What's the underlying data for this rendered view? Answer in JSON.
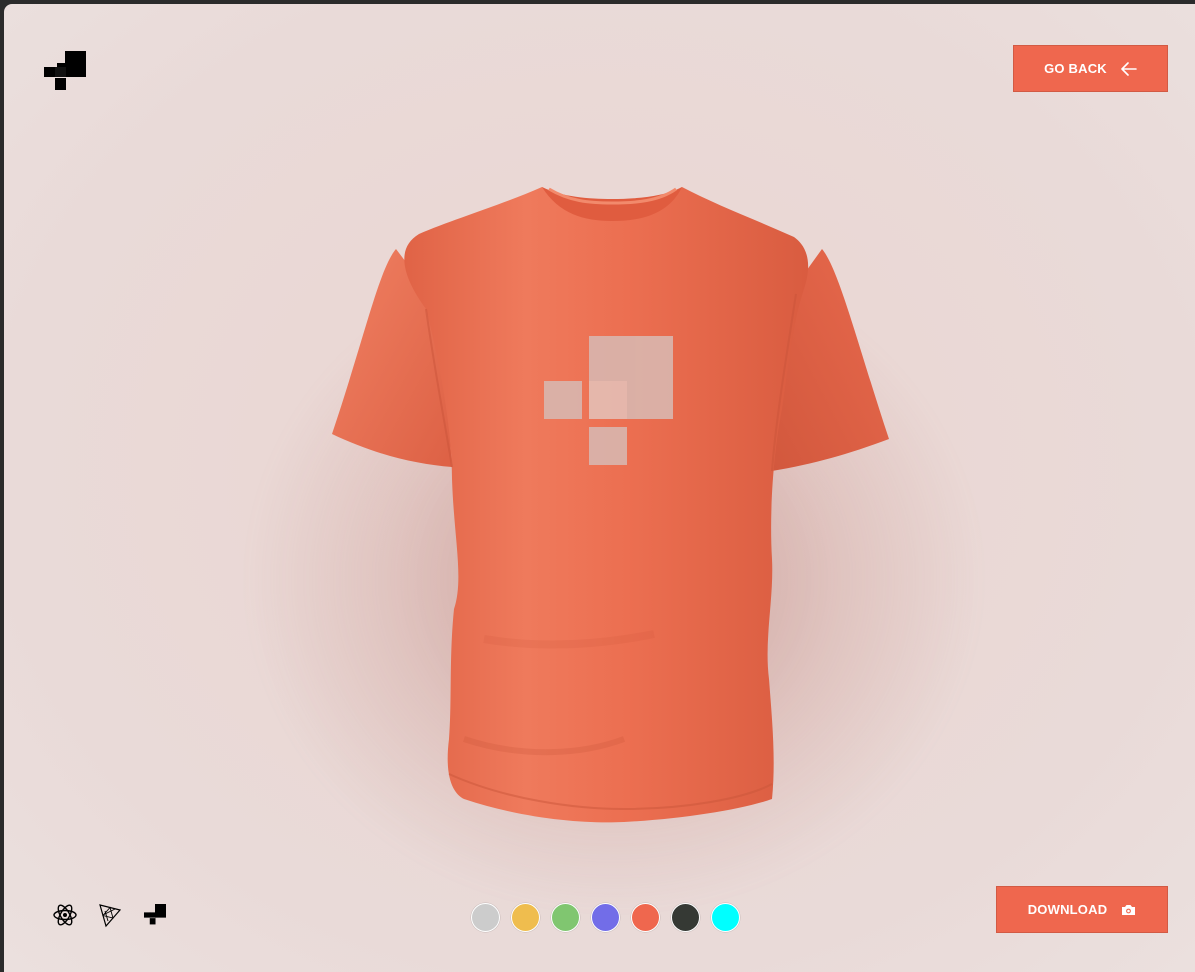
{
  "header": {
    "logo_icon": "brand-block-logo-icon",
    "go_back_label": "GO BACK",
    "go_back_icon": "arrow-left-icon"
  },
  "product": {
    "shirt_color": "#ef674e",
    "decal_icon": "brand-block-decal"
  },
  "footer": {
    "tools": [
      {
        "icon": "react-atom-icon"
      },
      {
        "icon": "threejs-triangle-icon"
      },
      {
        "icon": "brand-block-logo-icon"
      }
    ],
    "color_swatches": [
      "#cccccc",
      "#efbd4e",
      "#80c670",
      "#726de8",
      "#ef674e",
      "#353934",
      "#00ffff"
    ],
    "download_label": "DOWNLOAD",
    "download_icon": "camera-icon"
  },
  "colors": {
    "accent": "#ef674e",
    "background": "#ead8d5"
  }
}
